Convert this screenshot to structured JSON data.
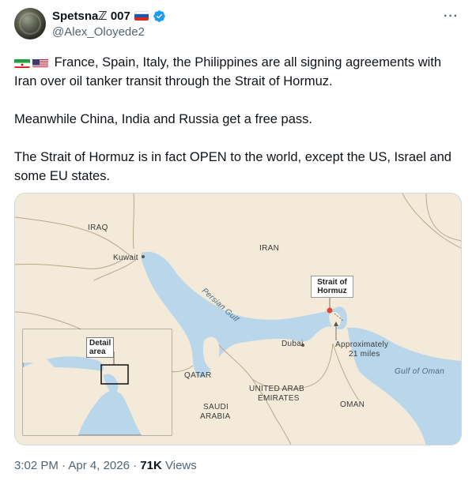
{
  "author": {
    "display_name": "Spetsnaℤ 007",
    "handle": "@Alex_Oloyede2",
    "verified": true
  },
  "tweet": {
    "paragraphs": [
      "France, Spain, Italy, the Philippines are all signing agreements with Iran over oil tanker transit through the Strait of Hormuz.",
      "Meanwhile China, India and Russia get a free pass.",
      "The Strait of Hormuz is in fact OPEN to the world, except the US, Israel and some EU states."
    ],
    "leading_flags": [
      "iran-flag-icon",
      "us-flag-icon"
    ]
  },
  "map": {
    "labels": {
      "iraq": "IRAQ",
      "kuwait": "Kuwait",
      "iran": "IRAN",
      "persian_gulf": "Persian Gulf",
      "strait": "Strait of Hormuz",
      "dubai": "Dubai",
      "approx": "Approximately",
      "approx_miles": "21 miles",
      "gulf_of_oman": "Gulf of Oman",
      "qatar": "QATAR",
      "uae_1": "UNITED ARAB",
      "uae_2": "EMIRATES",
      "oman": "OMAN",
      "saudi_1": "SAUDI",
      "saudi_2": "ARABIA",
      "detail_1": "Detail",
      "detail_2": "area"
    },
    "colors": {
      "land": "#f3ead9",
      "water": "#b9d6ea",
      "border": "#b8a88a",
      "marker": "#e8452f"
    }
  },
  "meta": {
    "time": "3:02 PM",
    "date": "Apr 4, 2026",
    "views_count": "71K",
    "views_label": "Views"
  }
}
